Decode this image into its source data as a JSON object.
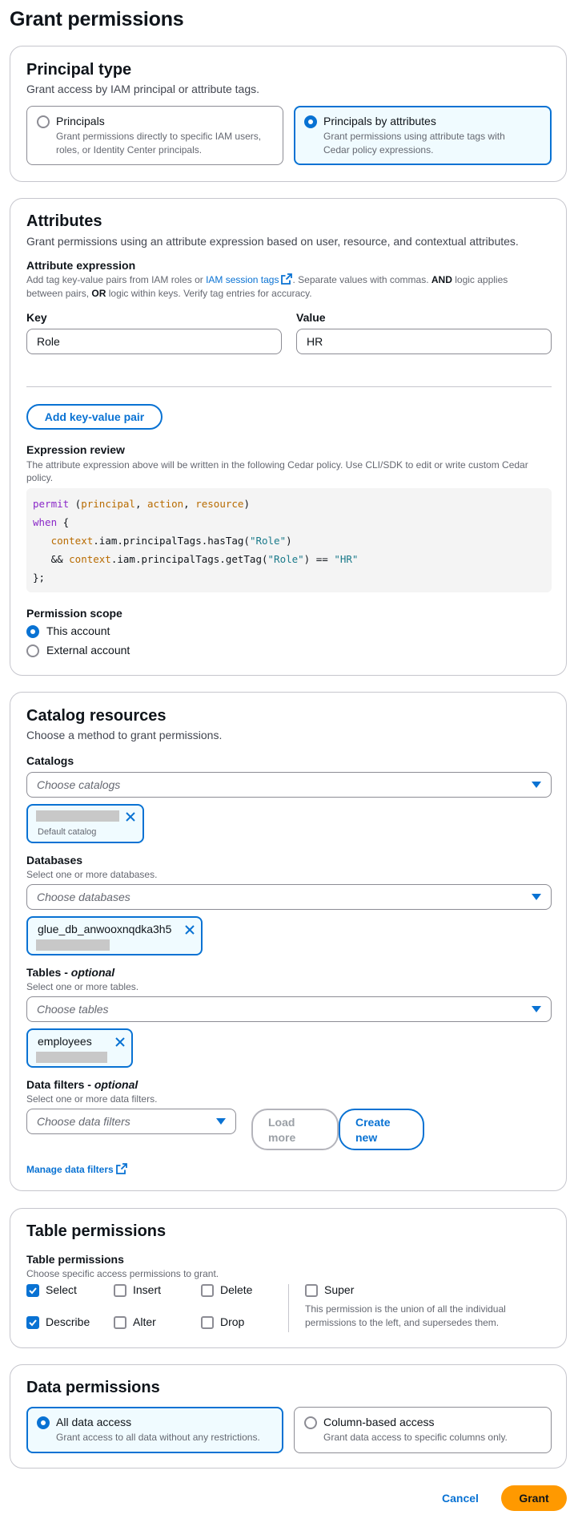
{
  "page": {
    "title": "Grant permissions"
  },
  "principal_type": {
    "heading": "Principal type",
    "description": "Grant access by IAM principal or attribute tags.",
    "options": [
      {
        "title": "Principals",
        "desc_line1": "Grant permissions directly to specific IAM users,",
        "desc_line2": "roles, or Identity Center principals.",
        "selected": false
      },
      {
        "title": "Principals by attributes",
        "desc_line1": "Grant permissions using attribute tags with",
        "desc_line2": "Cedar policy expressions.",
        "selected": true
      }
    ]
  },
  "attributes": {
    "heading": "Attributes",
    "description": "Grant permissions using an attribute expression based on user, resource, and contextual attributes.",
    "expression_label": "Attribute expression",
    "help_pre": "Add tag key-value pairs from IAM roles or ",
    "help_link": "IAM session tags",
    "help_post1": ". Separate values with commas. ",
    "help_and": "AND",
    "help_post2": " logic applies",
    "help_line2_pre": "between pairs, ",
    "help_or": "OR",
    "help_line2_post": " logic within keys. Verify tag entries for accuracy.",
    "key_label": "Key",
    "value_label": "Value",
    "key_value": "Role",
    "value_value": "HR",
    "add_pair_button": "Add key-value pair",
    "review_label": "Expression review",
    "review_help_line1": "The attribute expression above will be written in the following Cedar policy. Use CLI/SDK to edit or write custom Cedar",
    "review_help_line2": "policy.",
    "code": {
      "l1_kw": "permit",
      "l1_open": " (",
      "l1_v1": "principal",
      "l1_c1": ", ",
      "l1_v2": "action",
      "l1_c2": ", ",
      "l1_v3": "resource",
      "l1_close": ")",
      "l2_kw": "when",
      "l2_rest": " {",
      "l3_indent": "   ",
      "l3_ctx": "context",
      "l3_mid": ".iam.principalTags.hasTag(",
      "l3_str": "\"Role\"",
      "l3_end": ")",
      "l4_indent": "   && ",
      "l4_ctx": "context",
      "l4_mid": ".iam.principalTags.getTag(",
      "l4_str": "\"Role\"",
      "l4_mid2": ") == ",
      "l4_str2": "\"HR\"",
      "l5": "};"
    },
    "scope_label": "Permission scope",
    "scope_options": [
      {
        "label": "This account",
        "selected": true
      },
      {
        "label": "External account",
        "selected": false
      }
    ]
  },
  "catalog": {
    "heading": "Catalog resources",
    "description": "Choose a method to grant permissions.",
    "catalogs_label": "Catalogs",
    "catalogs_placeholder": "Choose catalogs",
    "catalog_token_sub": "Default catalog",
    "databases_label": "Databases",
    "databases_help": "Select one or more databases.",
    "databases_placeholder": "Choose databases",
    "database_token": "glue_db_anwooxnqdka3h5",
    "tables_label": "Tables - ",
    "tables_optional": "optional",
    "tables_help": "Select one or more tables.",
    "tables_placeholder": "Choose tables",
    "table_token": "employees",
    "filters_label": "Data filters - ",
    "filters_optional": "optional",
    "filters_help": "Select one or more data filters.",
    "filters_placeholder": "Choose data filters",
    "load_more_l1": "Load",
    "load_more_l2": "more",
    "create_new_l1": "Create",
    "create_new_l2": "new",
    "manage_filters": "Manage data filters"
  },
  "table_permissions": {
    "heading": "Table permissions",
    "label": "Table permissions",
    "help": "Choose specific access permissions to grant.",
    "options": [
      {
        "label": "Select",
        "checked": true
      },
      {
        "label": "Insert",
        "checked": false
      },
      {
        "label": "Delete",
        "checked": false
      },
      {
        "label": "Describe",
        "checked": true
      },
      {
        "label": "Alter",
        "checked": false
      },
      {
        "label": "Drop",
        "checked": false
      }
    ],
    "super_label": "Super",
    "super_desc_line1": "This permission is the union of all the individual",
    "super_desc_line2": "permissions to the left, and supersedes them."
  },
  "data_permissions": {
    "heading": "Data permissions",
    "options": [
      {
        "title": "All data access",
        "desc": "Grant access to all data without any restrictions.",
        "selected": true
      },
      {
        "title": "Column-based access",
        "desc": "Grant data access to specific columns only.",
        "selected": false
      }
    ]
  },
  "footer": {
    "cancel": "Cancel",
    "grant": "Grant"
  },
  "colors": {
    "accent": "#0972d3",
    "primary_button": "#ff9900",
    "selected_bg": "#f0fbff"
  }
}
